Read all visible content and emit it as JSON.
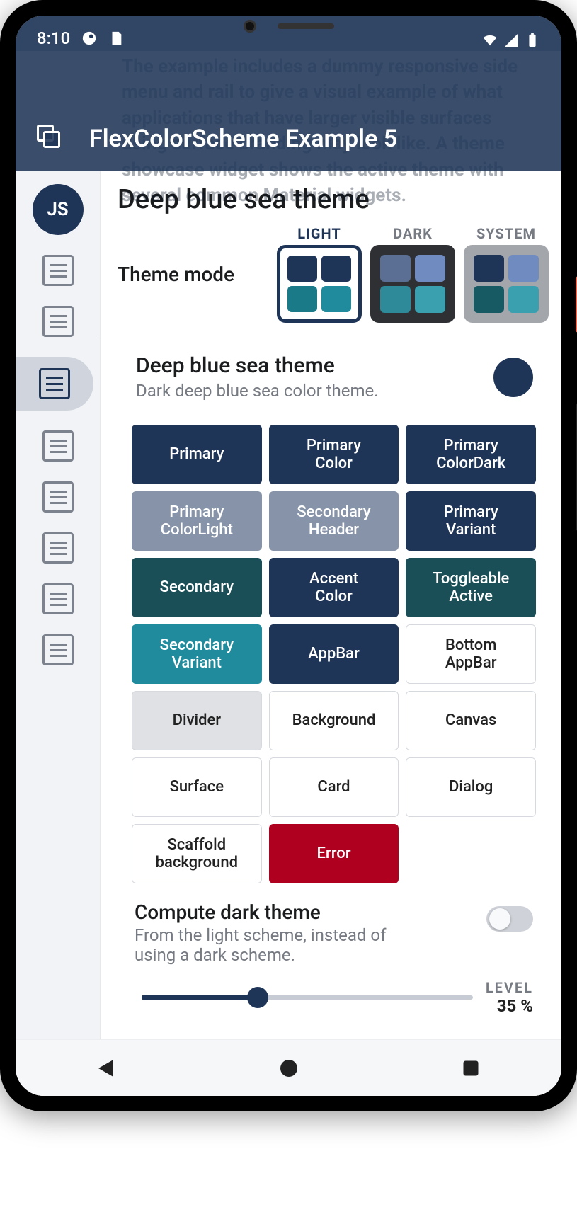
{
  "status": {
    "time": "8:10"
  },
  "ghost": "The example includes a dummy responsive side menu and rail to give a visual example of what applications that have larger visible surfaces using surface branding may look like. A theme showcase widget shows the active theme with several common Material widgets.",
  "appbar": {
    "title": "FlexColorScheme Example 5"
  },
  "rail": {
    "avatar": "JS"
  },
  "page": {
    "title": "Deep blue sea theme",
    "theme_mode_label": "Theme mode",
    "modes": {
      "light": "LIGHT",
      "dark": "DARK",
      "system": "SYSTEM"
    },
    "theme": {
      "name": "Deep blue sea theme",
      "desc": "Dark deep blue sea color theme."
    },
    "chips": [
      {
        "label": "Primary",
        "bg": "#1f3558",
        "fg": "#ffffff"
      },
      {
        "label": "Primary\nColor",
        "bg": "#1f3558",
        "fg": "#ffffff"
      },
      {
        "label": "Primary\nColorDark",
        "bg": "#1f3558",
        "fg": "#ffffff"
      },
      {
        "label": "Primary\nColorLight",
        "bg": "#8693a8",
        "fg": "#ffffff"
      },
      {
        "label": "Secondary\nHeader",
        "bg": "#8693a8",
        "fg": "#ffffff"
      },
      {
        "label": "Primary\nVariant",
        "bg": "#1f3558",
        "fg": "#ffffff"
      },
      {
        "label": "Secondary",
        "bg": "#1b4f57",
        "fg": "#ffffff"
      },
      {
        "label": "Accent\nColor",
        "bg": "#1f3558",
        "fg": "#ffffff"
      },
      {
        "label": "Toggleable\nActive",
        "bg": "#1b4f57",
        "fg": "#ffffff"
      },
      {
        "label": "Secondary\nVariant",
        "bg": "#1f8b9c",
        "fg": "#ffffff"
      },
      {
        "label": "AppBar",
        "bg": "#1f3558",
        "fg": "#ffffff"
      },
      {
        "label": "Bottom\nAppBar",
        "bg": "#ffffff",
        "fg": "#222222"
      },
      {
        "label": "Divider",
        "bg": "#e0e1e4",
        "fg": "#222222"
      },
      {
        "label": "Background",
        "bg": "#ffffff",
        "fg": "#222222"
      },
      {
        "label": "Canvas",
        "bg": "#ffffff",
        "fg": "#222222"
      },
      {
        "label": "Surface",
        "bg": "#ffffff",
        "fg": "#222222"
      },
      {
        "label": "Card",
        "bg": "#ffffff",
        "fg": "#222222"
      },
      {
        "label": "Dialog",
        "bg": "#ffffff",
        "fg": "#222222"
      },
      {
        "label": "Scaffold\nbackground",
        "bg": "#ffffff",
        "fg": "#222222"
      },
      {
        "label": "Error",
        "bg": "#b00020",
        "fg": "#ffffff"
      }
    ],
    "compute": {
      "title": "Compute dark theme",
      "desc": "From the light scheme, instead of using a dark scheme."
    },
    "slider": {
      "label": "LEVEL",
      "value": "35 %",
      "percent": 35
    }
  },
  "swatches": {
    "light": [
      "#1f3558",
      "#1f3558",
      "#1b7a88",
      "#1f8b9c"
    ],
    "dark": [
      "#5a6f93",
      "#6f8bbf",
      "#2e8a99",
      "#3aa0b0"
    ],
    "system": [
      "#1f3558",
      "#6f8bbf",
      "#175a64",
      "#3aa0b0"
    ]
  }
}
